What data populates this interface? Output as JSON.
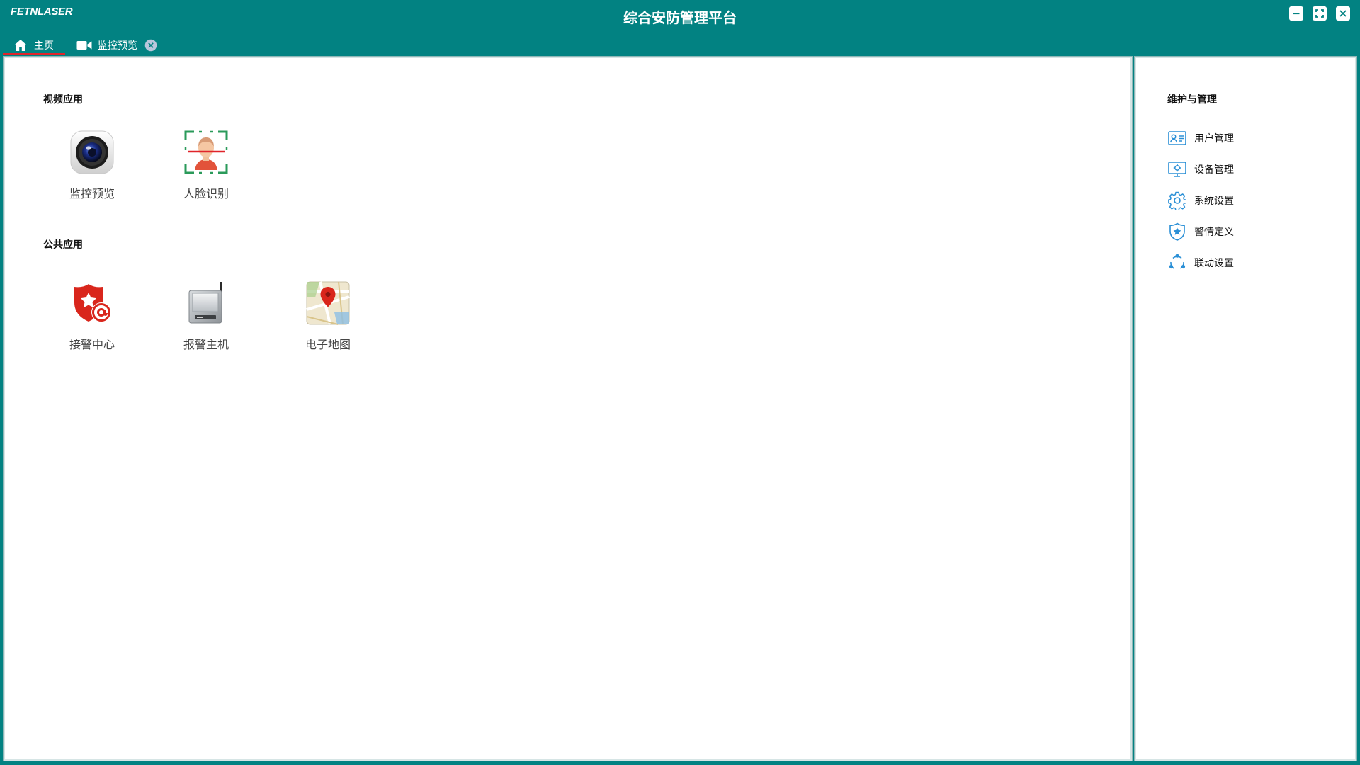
{
  "window": {
    "logo": "FETNLASER",
    "title": "综合安防管理平台",
    "buttons": [
      "minimize-icon",
      "maximize-icon",
      "close-icon"
    ]
  },
  "tabs": [
    {
      "label": "主页",
      "icon": "home-icon",
      "active": true
    },
    {
      "label": "监控预览",
      "icon": "video-camera-icon",
      "closable": true
    }
  ],
  "main": {
    "sections": [
      {
        "title": "视频应用",
        "apps": [
          {
            "label": "监控预览",
            "icon": "camera-lens-icon"
          },
          {
            "label": "人脸识别",
            "icon": "face-scan-icon"
          }
        ]
      },
      {
        "title": "公共应用",
        "apps": [
          {
            "label": "接警中心",
            "icon": "police-shield-icon"
          },
          {
            "label": "报警主机",
            "icon": "alarm-host-icon"
          },
          {
            "label": "电子地图",
            "icon": "map-pin-icon"
          }
        ]
      }
    ]
  },
  "sidebar": {
    "title": "维护与管理",
    "items": [
      {
        "label": "用户管理",
        "icon": "user-card-icon"
      },
      {
        "label": "设备管理",
        "icon": "device-monitor-icon"
      },
      {
        "label": "系统设置",
        "icon": "gear-icon"
      },
      {
        "label": "警情定义",
        "icon": "shield-star-icon"
      },
      {
        "label": "联动设置",
        "icon": "linkage-cycle-icon"
      }
    ]
  },
  "colors": {
    "chrome": "#028282",
    "active_tab_underline": "#e0242a",
    "sidebar_icon": "#2a8fd6",
    "panel_background": "#ffffff"
  }
}
